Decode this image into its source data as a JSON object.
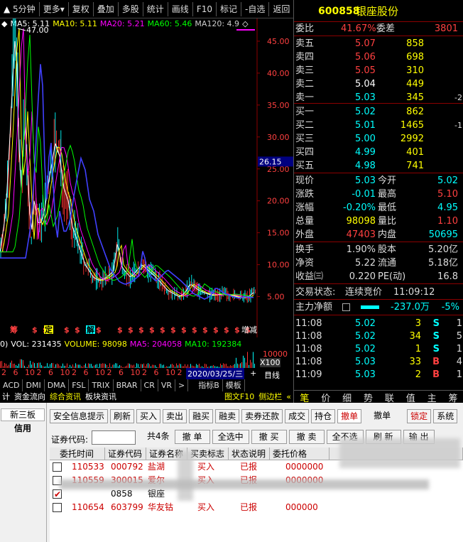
{
  "toolbar": {
    "items": [
      "5分钟",
      "更多",
      "复权",
      "叠加",
      "多股",
      "统计",
      "画线",
      "F10",
      "标记",
      "-自选",
      "返回"
    ]
  },
  "legend": {
    "ma5": "MA5: 5.11",
    "ma10": "MA10: 5.11",
    "ma20": "MA20: 5.21",
    "ma60": "MA60: 5.46",
    "ma120": "MA120: 4.9"
  },
  "colors": {
    "ma5": "#ffffff",
    "ma10": "#ffff00",
    "ma20": "#ff00ff",
    "ma60": "#00ff00",
    "ma120": "#cccccc"
  },
  "price_axis": [
    "45.00",
    "40.00",
    "35.00",
    "30.00",
    "25.00",
    "20.00",
    "15.00",
    "10.00",
    "5.00"
  ],
  "peak_label": "47.00",
  "cursor_price": "26.15",
  "markers": [
    "筹",
    "$",
    "$",
    "定",
    "$",
    "$",
    "$",
    "$",
    "解",
    "$",
    "$",
    "$",
    "$",
    "$",
    "$",
    "$",
    "$",
    "$",
    "$",
    "$",
    "$",
    "$",
    "$",
    "增减"
  ],
  "volume": {
    "prefix": "0)",
    "vol": "VOL: 231435",
    "volume": "VOLUME: 98098",
    "ma5": "MA5: 204058",
    "ma10": "MA10: 192384",
    "scale_top": "10000",
    "scale_unit": "X100"
  },
  "datebar": {
    "ticks": [
      "2",
      "6",
      "10",
      "2",
      "6",
      "10",
      "2",
      "6",
      "10",
      "2",
      "6",
      "10",
      "2",
      "6",
      "10",
      "2"
    ],
    "cursor_date": "2020/03/25/三",
    "period": "日线"
  },
  "indicators": [
    "ACD",
    "DMI",
    "DMA",
    "FSL",
    "TRIX",
    "BRAR",
    "CR",
    "VR",
    ">",
    "指标B",
    "模板"
  ],
  "bottom_tabs": [
    "计",
    "资金流向",
    "综合资讯",
    "板块资讯",
    "图文F10",
    "侧边栏",
    "«"
  ],
  "stock": {
    "code": "600858",
    "name": "银座股份"
  },
  "order": {
    "wb_label": "委比",
    "wb": "41.67%",
    "wc_label": "委差",
    "wc": "3801"
  },
  "sells": [
    {
      "label": "卖五",
      "price": "5.07",
      "vol": "858",
      "chg": ""
    },
    {
      "label": "卖四",
      "price": "5.06",
      "vol": "698",
      "chg": ""
    },
    {
      "label": "卖三",
      "price": "5.05",
      "vol": "310",
      "chg": ""
    },
    {
      "label": "卖二",
      "price": "5.04",
      "vol": "449",
      "chg": ""
    },
    {
      "label": "卖一",
      "price": "5.03",
      "vol": "345",
      "chg": "-2"
    }
  ],
  "buys": [
    {
      "label": "买一",
      "price": "5.02",
      "vol": "862",
      "chg": ""
    },
    {
      "label": "买二",
      "price": "5.01",
      "vol": "1465",
      "chg": "-1"
    },
    {
      "label": "买三",
      "price": "5.00",
      "vol": "2992",
      "chg": ""
    },
    {
      "label": "买四",
      "price": "4.99",
      "vol": "401",
      "chg": ""
    },
    {
      "label": "买五",
      "price": "4.98",
      "vol": "741",
      "chg": ""
    }
  ],
  "quote": [
    {
      "l1": "现价",
      "v1": "5.03",
      "l2": "今开",
      "v2": "5.02",
      "c1": "#00ffff",
      "c2": "#00ffff"
    },
    {
      "l1": "涨跌",
      "v1": "-0.01",
      "l2": "最高",
      "v2": "5.10",
      "c1": "#00ffff",
      "c2": "#ff4040"
    },
    {
      "l1": "涨幅",
      "v1": "-0.20%",
      "l2": "最低",
      "v2": "4.95",
      "c1": "#00ffff",
      "c2": "#00ffff"
    },
    {
      "l1": "总量",
      "v1": "98098",
      "l2": "量比",
      "v2": "1.10",
      "c1": "#ffff00",
      "c2": "#ff4040"
    },
    {
      "l1": "外盘",
      "v1": "47403",
      "l2": "内盘",
      "v2": "50695",
      "c1": "#ff4040",
      "c2": "#00ffff"
    }
  ],
  "stats": [
    {
      "l1": "换手",
      "v1": "1.90%",
      "l2": "股本",
      "v2": "5.20亿"
    },
    {
      "l1": "净资",
      "v1": "5.22",
      "l2": "流通",
      "v2": "5.18亿"
    },
    {
      "l1": "收益㈢",
      "v1": "0.220",
      "l2": "PE(动)",
      "v2": "16.8"
    }
  ],
  "trade_status": {
    "label": "交易状态:",
    "value": "连续竞价",
    "time": "11:09:12"
  },
  "main_flow": {
    "label": "主力净额",
    "value": "-237.0万",
    "pct": "-5%"
  },
  "ticks": [
    {
      "t": "11:08",
      "p": "5.02",
      "v": "3",
      "d": "S",
      "n": "1"
    },
    {
      "t": "11:08",
      "p": "5.02",
      "v": "34",
      "d": "S",
      "n": "5"
    },
    {
      "t": "11:08",
      "p": "5.02",
      "v": "1",
      "d": "S",
      "n": "1"
    },
    {
      "t": "11:08",
      "p": "5.03",
      "v": "33",
      "d": "B",
      "n": "4"
    },
    {
      "t": "11:09",
      "p": "5.03",
      "v": "2",
      "d": "B",
      "n": "1"
    }
  ],
  "right_tabs": [
    "笔",
    "价",
    "细",
    "势",
    "联",
    "值",
    "主",
    "筹"
  ],
  "bottom_left": {
    "tab1": "新三板",
    "tab2": "信用"
  },
  "trade_buttons": [
    "安全信息提示",
    "刷新",
    "买入",
    "卖出",
    "融买",
    "融卖",
    "卖券还款",
    "成交",
    "持仓",
    "撤单",
    "撤单",
    "锁定",
    "系统"
  ],
  "code_label": "证券代码:",
  "row2_buttons": [
    "共4条",
    "撤 单",
    "全选中",
    "撤 买",
    "撤 卖",
    "全不选",
    "刷 新",
    "输 出"
  ],
  "grid_headers": [
    "委托时间",
    "证券代码",
    "证券名称",
    "买卖标志",
    "状态说明",
    "委托价格"
  ],
  "orders": [
    {
      "time": "110533",
      "code": "000792",
      "name": "盐湖",
      "side": "买入",
      "status": "已报",
      "price": "1",
      "tail": "0000000",
      "checked": false
    },
    {
      "time": "110559",
      "code": "300015",
      "name": "爱尔",
      "side": "买入",
      "status": "已报",
      "price": "1",
      "tail": "0000000",
      "checked": false
    },
    {
      "time": "",
      "code": "0858",
      "name": "银座",
      "side": "",
      "status": "",
      "price": "",
      "tail": "",
      "checked": true
    },
    {
      "time": "110654",
      "code": "603799",
      "name": "华友钴",
      "side": "买入",
      "status": "已报",
      "price": "3",
      "tail": "000000",
      "checked": false
    }
  ]
}
